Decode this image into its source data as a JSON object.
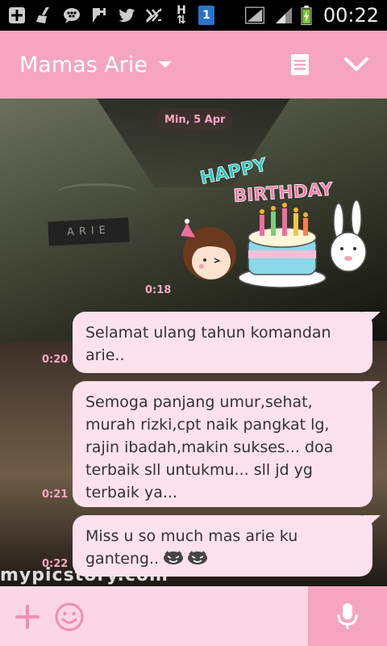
{
  "status_bar": {
    "time": "00:22",
    "sim_slot": "1",
    "network_type": "H",
    "icons": [
      "add-box-icon",
      "broom-icon",
      "bbm-icon",
      "pin-icon",
      "twitter-icon",
      "data-blocked-icon",
      "network-h-icon",
      "sim-1-icon",
      "signal-icon",
      "signal-2-icon",
      "battery-charging-icon"
    ]
  },
  "header": {
    "title": "Mamas Arie",
    "icons": [
      "dropdown-caret-icon",
      "notes-icon",
      "chevron-down-icon"
    ],
    "color": "#f6a5c0"
  },
  "chat": {
    "date_label": "Min, 5 Apr",
    "background_watermark": "mypicstory.com",
    "background_nametag": "ARIE",
    "sticker": {
      "title_word_1": "HAPPY",
      "title_word_2": "BIRTHDAY",
      "time": "0:18"
    },
    "messages": [
      {
        "text": "Selamat ulang tahun komandan\narie..",
        "time": "0:20"
      },
      {
        "text": "Semoga panjang umur,sehat,\nmurah rizki,cpt naik pangkat lg,\nrajin ibadah,makin sukses... doa\nterbaik sll untukmu... sll jd yg\nterbaik ya...",
        "time": "0:21"
      },
      {
        "text": "Miss u so much mas arie ku\nganteng..",
        "time": "0:22",
        "emoji": [
          "laughing-face-icon",
          "laughing-face-icon"
        ]
      }
    ],
    "bubble_color": "#fde1ec",
    "time_color": "#f7a8c3"
  },
  "input_bar": {
    "icons": [
      "plus-icon",
      "smiley-icon",
      "microphone-icon"
    ],
    "background": "#fbd6e4",
    "mic_background": "#f6a5c0"
  }
}
